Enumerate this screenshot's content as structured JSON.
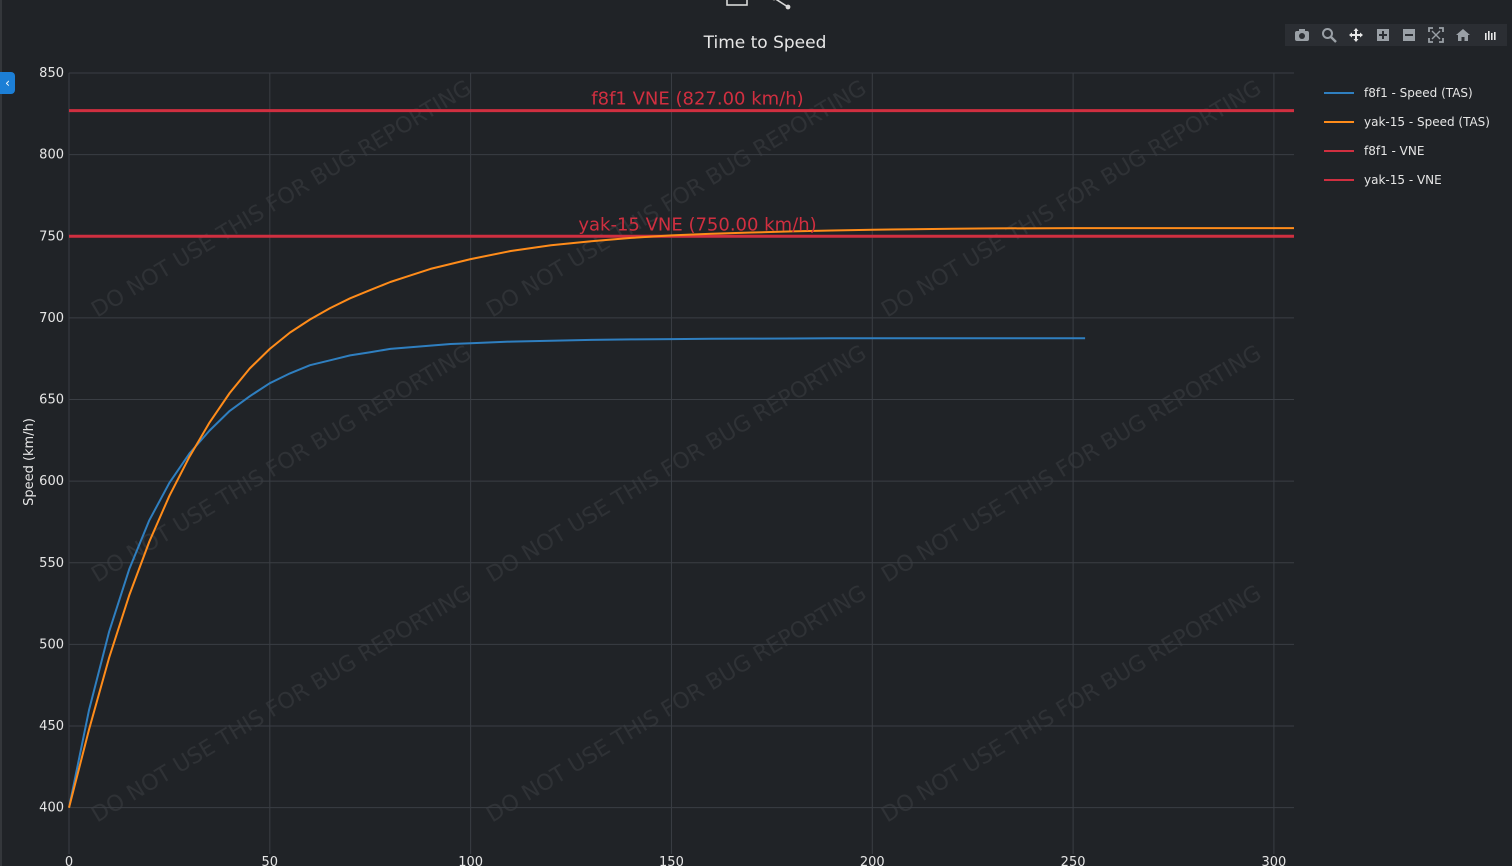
{
  "chart_data": {
    "type": "line",
    "title": "Time to Speed",
    "xlabel": "",
    "ylabel": "Speed (km/h)",
    "xlim": [
      0,
      305
    ],
    "ylim": [
      390,
      850
    ],
    "xticks": [
      0,
      50,
      100,
      150,
      200,
      250,
      300
    ],
    "yticks": [
      400,
      450,
      500,
      550,
      600,
      650,
      700,
      750,
      800,
      850
    ],
    "grid": true,
    "legend_position": "top-right",
    "series": [
      {
        "name": "f8f1 - Speed (TAS)",
        "color": "#2f7fc0",
        "x": [
          0,
          5,
          10,
          15,
          20,
          25,
          30,
          35,
          40,
          45,
          50,
          55,
          60,
          65,
          70,
          75,
          80,
          85,
          90,
          95,
          100,
          110,
          120,
          130,
          140,
          150,
          160,
          170,
          180,
          190,
          200,
          210,
          220,
          230,
          240,
          253
        ],
        "y": [
          400,
          460,
          508,
          546,
          576,
          599,
          617,
          631,
          643,
          652,
          660,
          666,
          671,
          674,
          677,
          679,
          681,
          682,
          683,
          684,
          684.5,
          685.5,
          686,
          686.5,
          686.8,
          687,
          687.2,
          687.3,
          687.4,
          687.5,
          687.5,
          687.5,
          687.5,
          687.5,
          687.5,
          687.5
        ]
      },
      {
        "name": "yak-15 - Speed (TAS)",
        "color": "#ff8c1a",
        "x": [
          0,
          5,
          10,
          15,
          20,
          25,
          30,
          35,
          40,
          45,
          50,
          55,
          60,
          65,
          70,
          75,
          80,
          85,
          90,
          95,
          100,
          110,
          120,
          130,
          140,
          150,
          160,
          170,
          180,
          190,
          200,
          210,
          220,
          230,
          250,
          270,
          305
        ],
        "y": [
          400,
          448,
          492,
          530,
          563,
          591,
          615,
          636,
          654,
          669,
          681,
          691,
          699,
          706,
          712,
          717,
          722,
          726,
          730,
          733,
          736,
          741,
          744.5,
          747,
          749,
          750.5,
          751.5,
          752.3,
          753,
          753.5,
          754,
          754.3,
          754.6,
          754.8,
          755,
          755,
          755
        ]
      },
      {
        "name": "f8f1 - VNE",
        "color": "#d02f40",
        "x": [
          0,
          305
        ],
        "y": [
          827,
          827
        ]
      },
      {
        "name": "yak-15 - VNE",
        "color": "#d02f40",
        "x": [
          0,
          305
        ],
        "y": [
          750,
          750
        ]
      }
    ],
    "annotations": [
      {
        "text": "f8f1 VNE (827.00 km/h)",
        "x": 152,
        "y": 827,
        "color": "#d02f40"
      },
      {
        "text": "yak-15 VNE (750.00 km/h)",
        "x": 152,
        "y": 750,
        "color": "#d02f40"
      }
    ],
    "watermark": "DO NOT USE THIS FOR BUG REPORTING"
  },
  "ui": {
    "collapse_label": "‹",
    "modebar_icons": [
      "camera-icon",
      "zoom-icon",
      "pan-icon",
      "zoom-in-icon",
      "zoom-out-icon",
      "autoscale-icon",
      "home-icon",
      "plotly-logo-icon"
    ],
    "top_icons": [
      "window-icon",
      "share-icon"
    ],
    "colors": {
      "background": "#202327",
      "grid": "#3a3e44",
      "axis_text": "#e6e6e6",
      "accent": "#1c7fd6"
    }
  }
}
